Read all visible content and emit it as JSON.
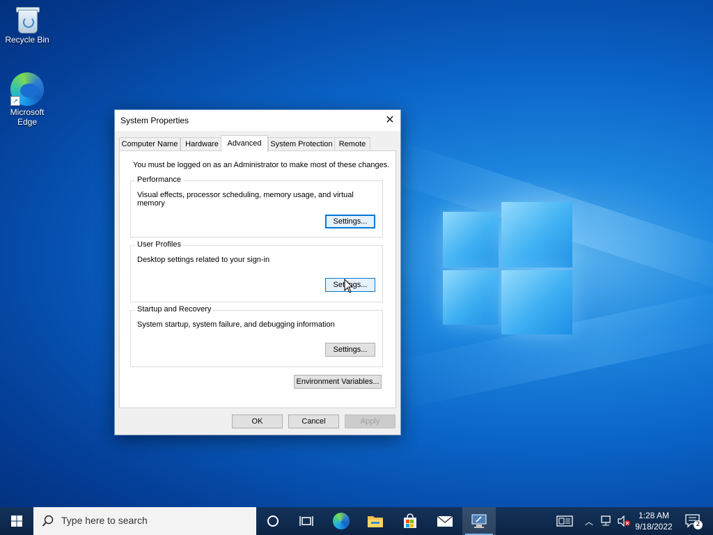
{
  "desktop": {
    "icons": [
      {
        "label": "Recycle Bin",
        "icon": "recycle-bin-icon"
      },
      {
        "label": "Microsoft Edge",
        "icon": "edge-icon"
      }
    ]
  },
  "dialog": {
    "title": "System Properties",
    "tabs": [
      {
        "label": "Computer Name"
      },
      {
        "label": "Hardware"
      },
      {
        "label": "Advanced"
      },
      {
        "label": "System Protection"
      },
      {
        "label": "Remote"
      }
    ],
    "active_tab": "Advanced",
    "admin_note": "You must be logged on as an Administrator to make most of these changes.",
    "groups": [
      {
        "label": "Performance",
        "description": "Visual effects, processor scheduling, memory usage, and virtual memory",
        "button": "Settings..."
      },
      {
        "label": "User Profiles",
        "description": "Desktop settings related to your sign-in",
        "button": "Settings..."
      },
      {
        "label": "Startup and Recovery",
        "description": "System startup, system failure, and debugging information",
        "button": "Settings..."
      }
    ],
    "env_button": "Environment Variables...",
    "ok": "OK",
    "cancel": "Cancel",
    "apply": "Apply"
  },
  "taskbar": {
    "search_placeholder": "Type here to search",
    "pinned": [
      "cortana-icon",
      "task-view-icon",
      "edge-icon",
      "file-explorer-icon",
      "store-icon",
      "mail-icon",
      "system-properties-icon"
    ],
    "clock_time": "1:28 AM",
    "clock_date": "9/18/2022",
    "notification_count": "2"
  },
  "colors": {
    "accent": "#0078d7",
    "taskbar": "#0c2444"
  }
}
